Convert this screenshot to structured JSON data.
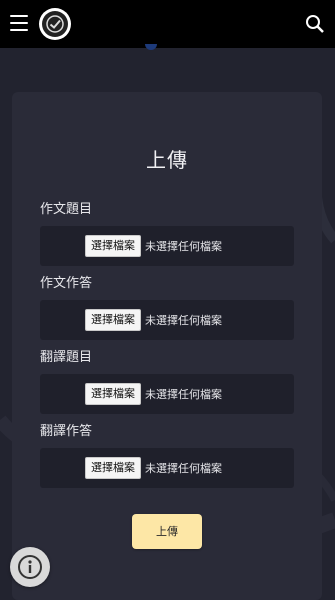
{
  "header": {
    "menu_icon": "hamburger-menu-icon",
    "logo_icon": "checkmark-badge-logo",
    "search_icon": "search-icon"
  },
  "card": {
    "title": "上傳",
    "fields": [
      {
        "label": "作文題目",
        "button_label": "選擇檔案",
        "status": "未選擇任何檔案"
      },
      {
        "label": "作文作答",
        "button_label": "選擇檔案",
        "status": "未選擇任何檔案"
      },
      {
        "label": "翻譯題目",
        "button_label": "選擇檔案",
        "status": "未選擇任何檔案"
      },
      {
        "label": "翻譯作答",
        "button_label": "選擇檔案",
        "status": "未選擇任何檔案"
      }
    ],
    "submit_label": "上傳"
  },
  "fab": {
    "icon": "info-icon"
  },
  "colors": {
    "background": "#22232f",
    "card": "#2a2b38",
    "header": "#000000",
    "submit_button": "#fde7a6"
  }
}
